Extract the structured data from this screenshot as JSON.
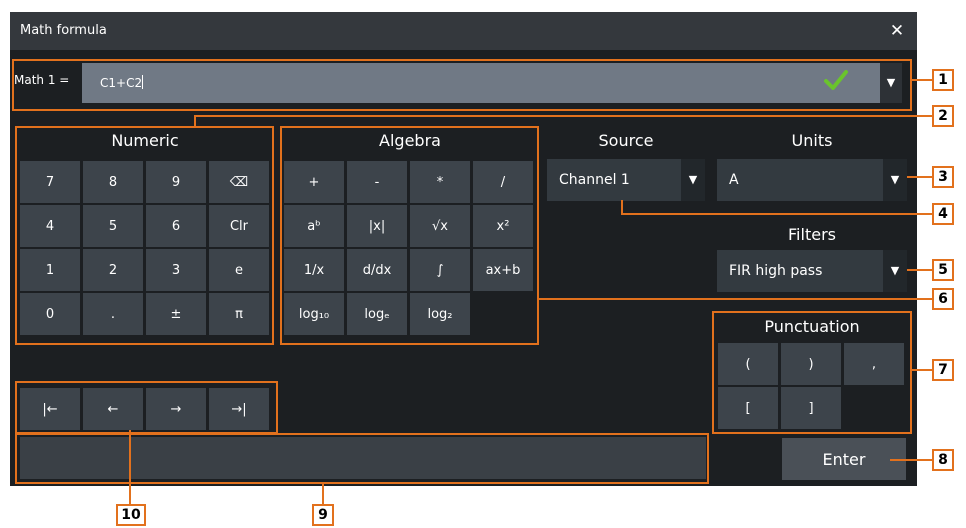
{
  "dialog": {
    "title": "Math formula",
    "close_icon": "close-icon"
  },
  "formula": {
    "label": "Math 1 =",
    "value": "C1+C2",
    "valid_color": "#6ac42c",
    "check_icon": "check-icon",
    "dropdown_icon": "chevron-down-icon"
  },
  "numeric": {
    "title": "Numeric",
    "keys": [
      "7",
      "8",
      "9",
      "⌫",
      "4",
      "5",
      "6",
      "Clr",
      "1",
      "2",
      "3",
      "e",
      "0",
      ".",
      "±",
      "π"
    ]
  },
  "algebra": {
    "title": "Algebra",
    "keys": [
      "+",
      "-",
      "*",
      "/",
      "aᵇ",
      "|x|",
      "√x",
      "x²",
      "1/x",
      "d/dx",
      "∫",
      "ax+b",
      "log₁₀",
      "logₑ",
      "log₂"
    ]
  },
  "source": {
    "title": "Source",
    "value": "Channel 1"
  },
  "units": {
    "title": "Units",
    "value": "A"
  },
  "filters": {
    "title": "Filters",
    "value": "FIR high pass"
  },
  "punctuation": {
    "title": "Punctuation",
    "keys": [
      "(",
      ")",
      ",",
      "[",
      "]"
    ]
  },
  "navigation": {
    "keys": [
      "|←",
      "←",
      "→",
      "→|"
    ]
  },
  "enter_label": "Enter",
  "callouts": [
    "1",
    "2",
    "3",
    "4",
    "5",
    "6",
    "7",
    "8",
    "9",
    "10"
  ],
  "colors": {
    "accent": "#e2711d",
    "background": "#1c1f22",
    "button": "#3d444b"
  }
}
